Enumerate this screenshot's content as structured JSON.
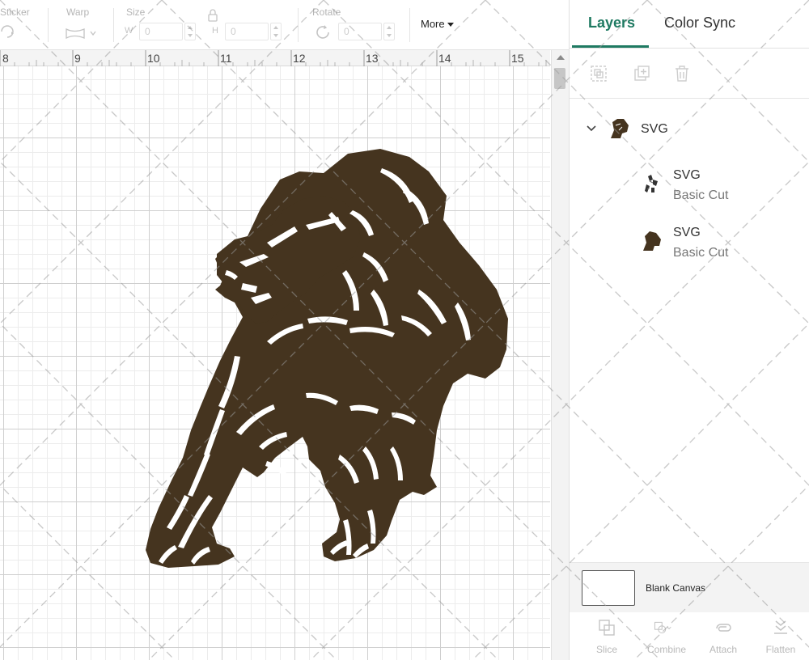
{
  "toolbar": {
    "sticker_label": "Sticker",
    "warp_label": "Warp",
    "size_label": "Size",
    "width_letter": "W",
    "width_value": "0",
    "height_letter": "H",
    "height_value": "0",
    "rotate_label": "Rotate",
    "rotate_value": "0",
    "more_label": "More"
  },
  "ruler": {
    "numbers": [
      "8",
      "9",
      "10",
      "11",
      "12",
      "13",
      "14",
      "15"
    ]
  },
  "canvas": {
    "artwork_color": "#45341f"
  },
  "panel": {
    "tabs": [
      {
        "label": "Layers",
        "active": true
      },
      {
        "label": "Color Sync",
        "active": false
      }
    ],
    "layers": {
      "group": {
        "name": "SVG"
      },
      "children": [
        {
          "name": "SVG",
          "operation": "Basic Cut"
        },
        {
          "name": "SVG",
          "operation": "Basic Cut"
        }
      ]
    },
    "blank_canvas_label": "Blank Canvas",
    "actions": [
      {
        "label": "Slice",
        "icon": "slice-icon"
      },
      {
        "label": "Combine",
        "icon": "combine-icon"
      },
      {
        "label": "Attach",
        "icon": "attach-icon"
      },
      {
        "label": "Flatten",
        "icon": "flatten-icon"
      }
    ]
  },
  "colors": {
    "accent": "#1f7a62",
    "artwork": "#45341f"
  }
}
